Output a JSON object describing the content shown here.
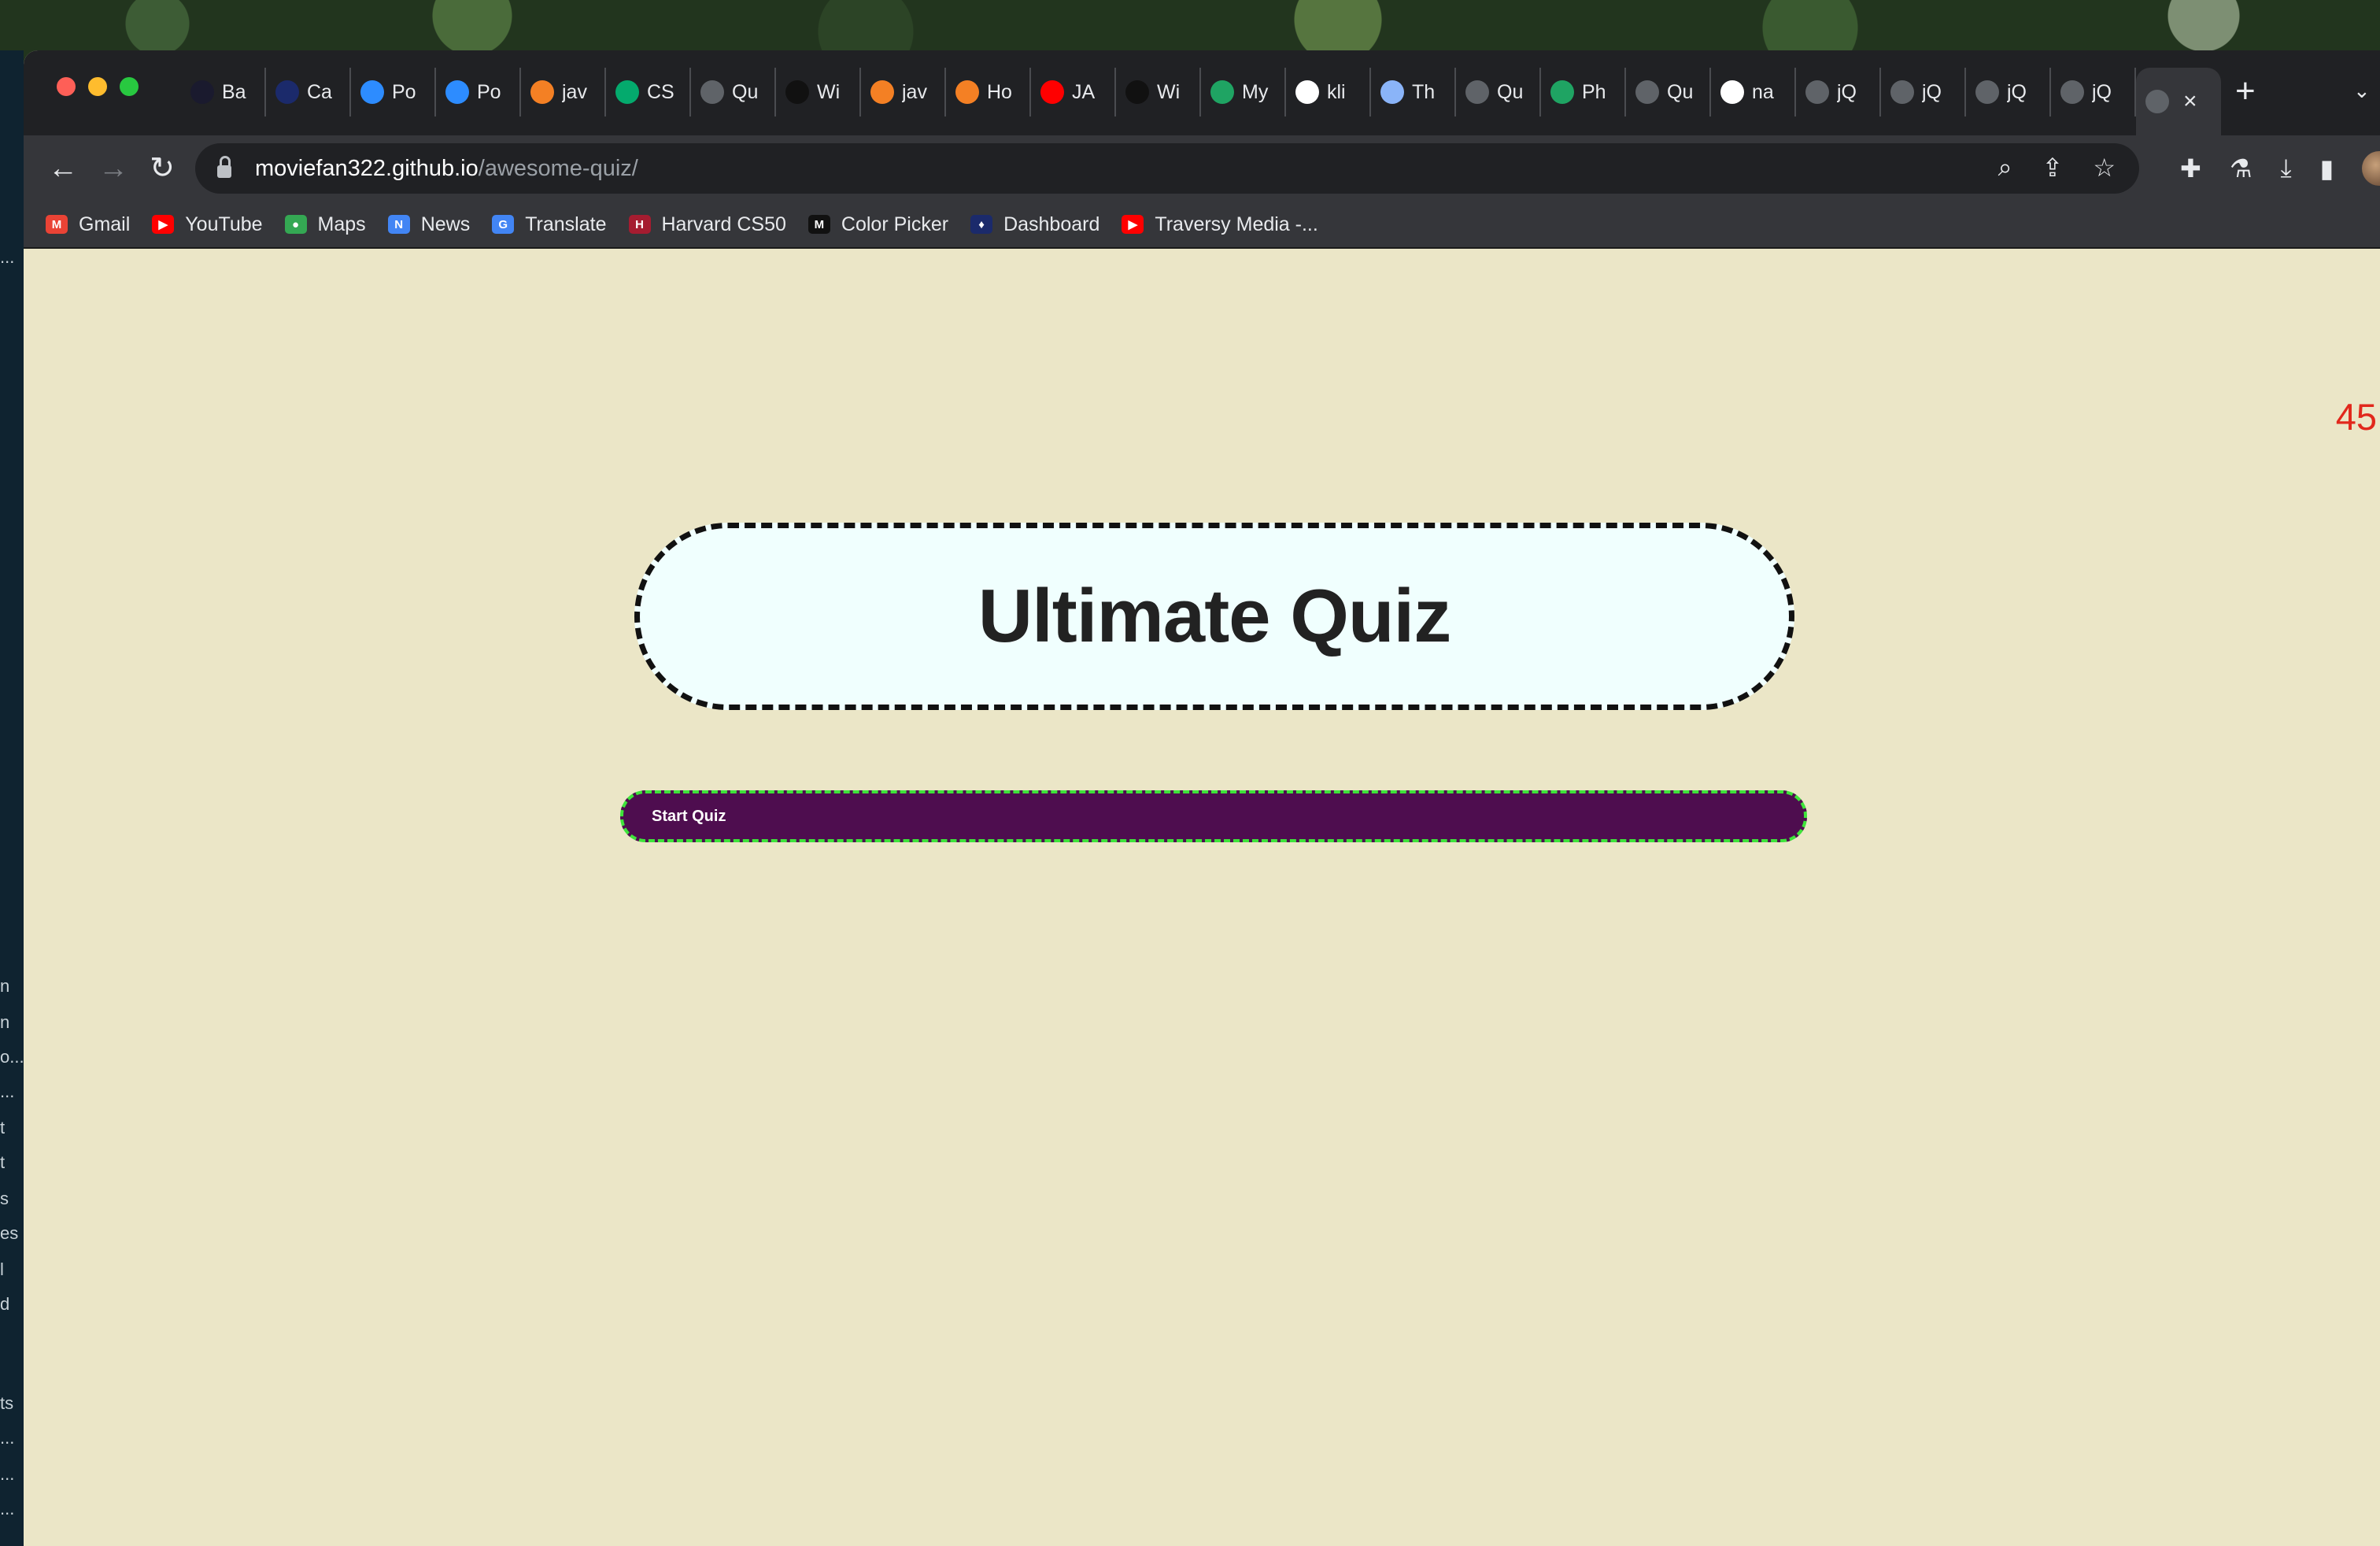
{
  "browser": {
    "tabs": [
      {
        "label": "Ba",
        "icon": "angular-icon",
        "color": "#1a1a2e"
      },
      {
        "label": "Ca",
        "icon": "dashboard-icon",
        "color": "#1b2a6b"
      },
      {
        "label": "Po",
        "icon": "zoom-icon",
        "color": "#2d8cff"
      },
      {
        "label": "Po",
        "icon": "zoom-icon",
        "color": "#2d8cff"
      },
      {
        "label": "jav",
        "icon": "stackoverflow-icon",
        "color": "#f48024"
      },
      {
        "label": "CS",
        "icon": "w3schools-icon",
        "color": "#04aa6d"
      },
      {
        "label": "Qu",
        "icon": "globe-icon",
        "color": "#5f6368"
      },
      {
        "label": "Wi",
        "icon": "mdn-icon",
        "color": "#111111"
      },
      {
        "label": "jav",
        "icon": "stackoverflow-icon",
        "color": "#f48024"
      },
      {
        "label": "Ho",
        "icon": "stackoverflow-icon",
        "color": "#f48024"
      },
      {
        "label": "JA",
        "icon": "youtube-icon",
        "color": "#ff0000"
      },
      {
        "label": "Wi",
        "icon": "mdn-icon",
        "color": "#111111"
      },
      {
        "label": "My",
        "icon": "drive-icon",
        "color": "#1fa463"
      },
      {
        "label": "kli",
        "icon": "google-icon",
        "color": "#ffffff"
      },
      {
        "label": "Th",
        "icon": "loading-icon",
        "color": "#8ab4f8"
      },
      {
        "label": "Qu",
        "icon": "globe-icon",
        "color": "#5f6368"
      },
      {
        "label": "Ph",
        "icon": "drive-icon",
        "color": "#1fa463"
      },
      {
        "label": "Qu",
        "icon": "globe-icon",
        "color": "#5f6368"
      },
      {
        "label": "na",
        "icon": "google-icon",
        "color": "#ffffff"
      },
      {
        "label": "jQ",
        "icon": "globe-icon",
        "color": "#5f6368"
      },
      {
        "label": "jQ",
        "icon": "globe-icon",
        "color": "#5f6368"
      },
      {
        "label": "jQ",
        "icon": "globe-icon",
        "color": "#5f6368"
      },
      {
        "label": "jQ",
        "icon": "globe-icon",
        "color": "#5f6368"
      }
    ],
    "active_tab_icon": "globe-icon",
    "url_host": "moviefan322.github.io",
    "url_path": "/awesome-quiz/",
    "bookmarks": [
      {
        "label": "Gmail",
        "icon": "gmail-icon",
        "color": "#ea4335",
        "glyph": "M"
      },
      {
        "label": "YouTube",
        "icon": "youtube-icon",
        "color": "#ff0000",
        "glyph": "▶"
      },
      {
        "label": "Maps",
        "icon": "maps-icon",
        "color": "#34a853",
        "glyph": "●"
      },
      {
        "label": "News",
        "icon": "news-icon",
        "color": "#4285f4",
        "glyph": "N"
      },
      {
        "label": "Translate",
        "icon": "translate-icon",
        "color": "#4285f4",
        "glyph": "G"
      },
      {
        "label": "Harvard CS50",
        "icon": "harvard-icon",
        "color": "#a51c30",
        "glyph": "H"
      },
      {
        "label": "Color Picker",
        "icon": "mdn-icon",
        "color": "#111111",
        "glyph": "M"
      },
      {
        "label": "Dashboard",
        "icon": "dashboard-icon",
        "color": "#1b2a6b",
        "glyph": "♦"
      },
      {
        "label": "Traversy Media -...",
        "icon": "youtube-icon",
        "color": "#ff0000",
        "glyph": "▶"
      }
    ]
  },
  "left_strip_text": [
    "...",
    "n",
    "n",
    "o...",
    "...",
    "t",
    "t",
    "s",
    "es",
    "l",
    "d",
    "ts",
    "...",
    "...",
    "..."
  ],
  "page": {
    "timer": "45",
    "title": "Ultimate Quiz",
    "start_button": "Start Quiz",
    "colors": {
      "background": "#ebe6c7",
      "title_box": "#f0fffe",
      "button_bg": "#4e0d4f",
      "button_border": "#3ee33a",
      "timer": "#e1281c"
    }
  }
}
